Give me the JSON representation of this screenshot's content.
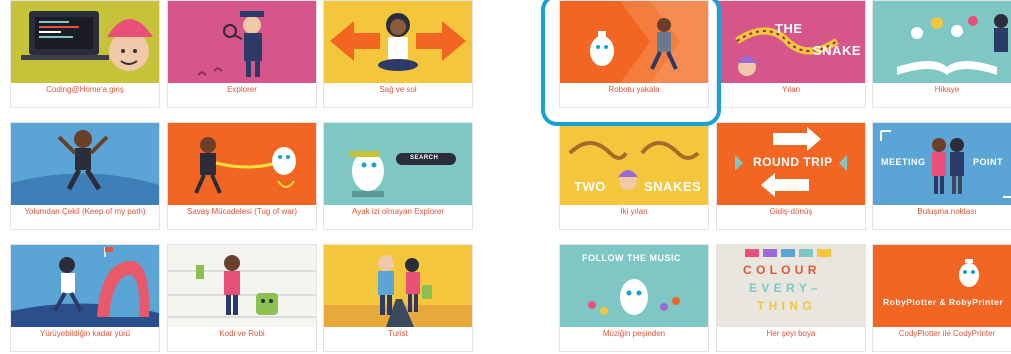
{
  "left_grid": {
    "cards": [
      {
        "caption": "Coding@Home'a giriş",
        "icon": "laptop-girl-thumbnail"
      },
      {
        "caption": "Explorer",
        "icon": "explorer-thumbnail"
      },
      {
        "caption": "Sağ ve sol",
        "icon": "left-right-thumbnail"
      },
      {
        "caption": "Yolumdan Çekil (Keep of my path)",
        "icon": "jumping-boy-thumbnail"
      },
      {
        "caption": "Savaş Mücadelesi (Tug of war)",
        "icon": "tug-of-war-thumbnail"
      },
      {
        "caption": "Ayak izi olmayan Explorer",
        "icon": "robot-search-thumbnail"
      },
      {
        "caption": "Yürüyebildiğin kadar yürü",
        "icon": "walking-boy-thumbnail"
      },
      {
        "caption": "Kodi ve Robi",
        "icon": "kodi-robi-thumbnail"
      },
      {
        "caption": "Turist",
        "icon": "tourist-thumbnail"
      }
    ]
  },
  "right_grid": {
    "cards": [
      {
        "caption": "Robotu yakala",
        "icon": "catch-robot-thumbnail",
        "selected": true
      },
      {
        "caption": "Yılan",
        "icon": "snake-thumbnail",
        "overlay": [
          "THE",
          "SNAKE"
        ]
      },
      {
        "caption": "Hikaye",
        "icon": "story-book-thumbnail"
      },
      {
        "caption": "İki yılan",
        "icon": "two-snakes-thumbnail",
        "overlay": [
          "TWO",
          "SNAKES"
        ]
      },
      {
        "caption": "Gidiş-dönüş",
        "icon": "round-trip-thumbnail",
        "overlay": [
          "ROUND TRIP"
        ]
      },
      {
        "caption": "Buluşma noktası",
        "icon": "meeting-point-thumbnail",
        "overlay": [
          "MEETING",
          "POINT"
        ]
      },
      {
        "caption": "Müziğin peşinden",
        "icon": "follow-music-thumbnail",
        "overlay": [
          "FOLLOW THE MUSIC"
        ]
      },
      {
        "caption": "Her şeyi boya",
        "icon": "colour-everything-thumbnail",
        "overlay": [
          "C O L O U R",
          "E V E R Y –",
          "T H I N G"
        ]
      },
      {
        "caption": "CodyPlotter ile CodyPrinter",
        "icon": "roby-plotter-thumbnail",
        "overlay": [
          "RobyPlotter & RobyPrinter"
        ]
      }
    ]
  },
  "search_badge": "SEARCH",
  "colors": {
    "caption": "#e2553a",
    "highlight": "#1a9fd6",
    "orange": "#f26522",
    "pink": "#d6558a",
    "teal": "#7ec7c4",
    "blue": "#5aa5d6",
    "yellow": "#f3c63c"
  }
}
